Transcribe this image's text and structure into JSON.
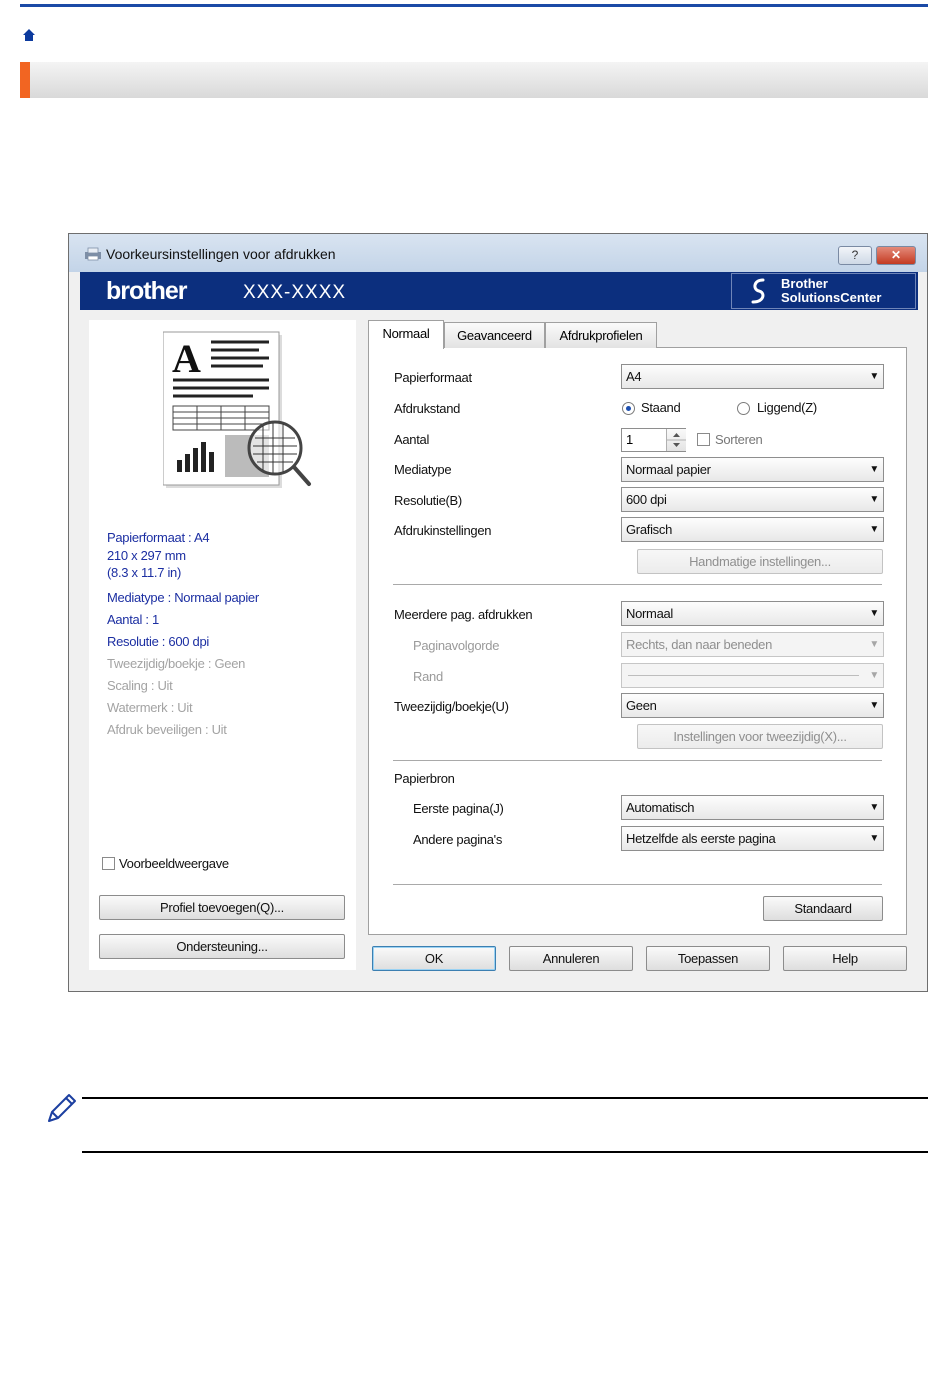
{
  "dialog": {
    "title": "Voorkeursinstellingen voor afdrukken",
    "help_btn": "?",
    "close_btn": "✕",
    "brand": "brother",
    "model": "XXX-XXXX",
    "solutions_line1": "Brother",
    "solutions_line2": "SolutionsCenter"
  },
  "summary": {
    "paper": "Papierformaat : A4",
    "size_mm": "210 x 297 mm",
    "size_in": "(8.3 x 11.7 in)",
    "media": "Mediatype : Normaal papier",
    "copies": "Aantal : 1",
    "resolution": "Resolutie : 600 dpi",
    "duplex": "Tweezijdig/boekje : Geen",
    "scaling": "Scaling : Uit",
    "watermark": "Watermerk : Uit",
    "secure": "Afdruk beveiligen : Uit"
  },
  "preview_check": "Voorbeeldweergave",
  "left_buttons": {
    "add_profile": "Profiel toevoegen(Q)...",
    "support": "Ondersteuning..."
  },
  "tabs": [
    "Normaal",
    "Geavanceerd",
    "Afdrukprofielen"
  ],
  "form": {
    "paper_size_label": "Papierformaat",
    "paper_size_value": "A4",
    "orientation_label": "Afdrukstand",
    "portrait": "Staand",
    "landscape": "Liggend(Z)",
    "copies_label": "Aantal",
    "copies_value": "1",
    "collate": "Sorteren",
    "media_label": "Mediatype",
    "media_value": "Normaal papier",
    "resolution_label": "Resolutie(B)",
    "resolution_value": "600 dpi",
    "print_settings_label": "Afdrukinstellingen",
    "print_settings_value": "Grafisch",
    "manual_btn": "Handmatige instellingen...",
    "multipage_label": "Meerdere pag. afdrukken",
    "multipage_value": "Normaal",
    "page_order_label": "Paginavolgorde",
    "page_order_value": "Rechts, dan naar beneden",
    "border_label": "Rand",
    "duplex_label": "Tweezijdig/boekje(U)",
    "duplex_value": "Geen",
    "duplex_btn": "Instellingen voor tweezijdig(X)...",
    "source_label": "Papierbron",
    "first_page_label": "Eerste pagina(J)",
    "first_page_value": "Automatisch",
    "other_pages_label": "Andere pagina's",
    "other_pages_value": "Hetzelfde als eerste pagina",
    "default_btn": "Standaard"
  },
  "footer_buttons": {
    "ok": "OK",
    "cancel": "Annuleren",
    "apply": "Toepassen",
    "help": "Help"
  },
  "colors": {
    "banner": "#0c2f7e",
    "accent": "#f26522",
    "info_text": "#1c2fa2"
  }
}
